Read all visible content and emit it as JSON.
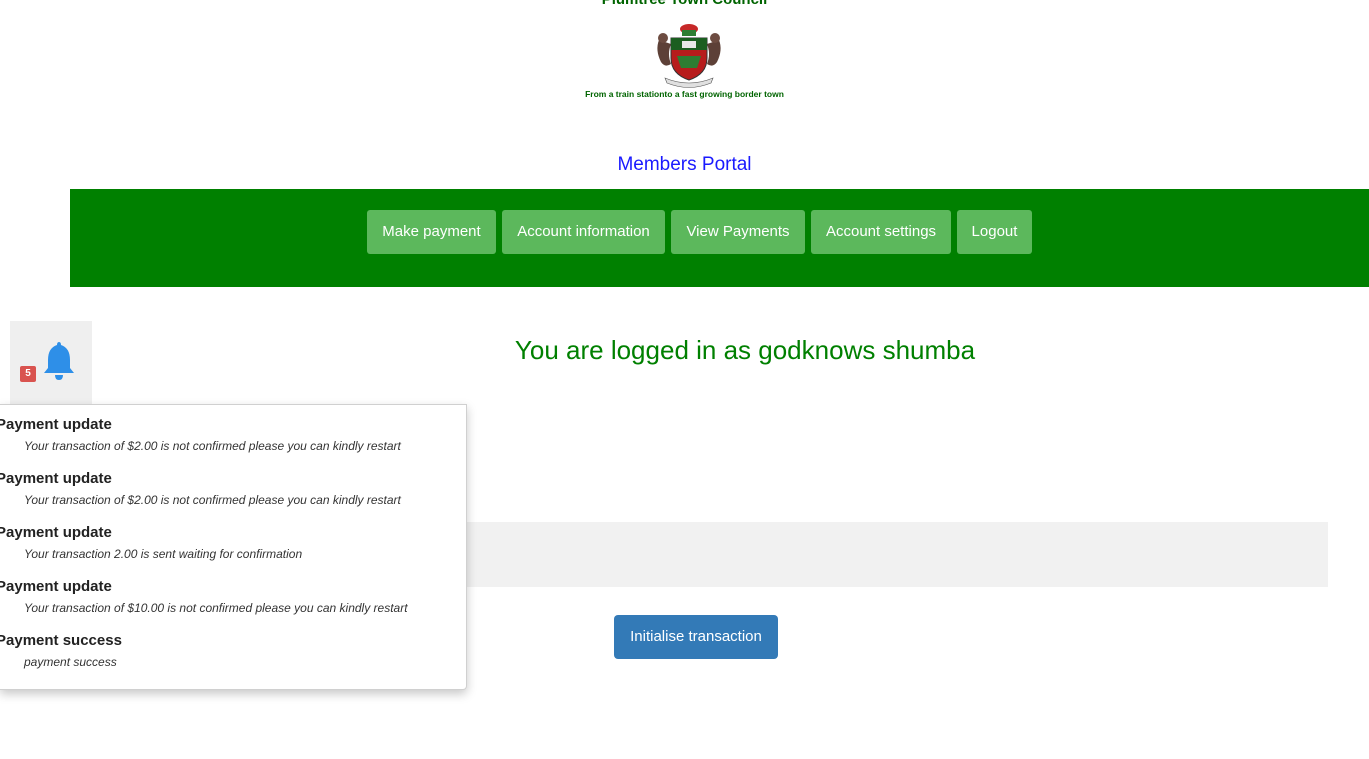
{
  "header": {
    "council_name": "Plumtree Town Council",
    "motto": "From a train stationto a fast growing border town",
    "portal_title": "Members Portal"
  },
  "nav": {
    "items": [
      {
        "label": "Make payment"
      },
      {
        "label": "Account information"
      },
      {
        "label": "View Payments"
      },
      {
        "label": "Account settings"
      },
      {
        "label": "Logout"
      }
    ]
  },
  "notifications": {
    "count": "5",
    "icon": "bell-icon",
    "items": [
      {
        "title": "Payment update",
        "message": "Your transaction of $2.00 is not confirmed please you can kindly restart"
      },
      {
        "title": "Payment update",
        "message": "Your transaction of $2.00 is not confirmed please you can kindly restart"
      },
      {
        "title": "Payment update",
        "message": "Your transaction 2.00 is sent waiting for confirmation"
      },
      {
        "title": "Payment update",
        "message": "Your transaction of $10.00 is not confirmed please you can kindly restart"
      },
      {
        "title": "Payment success",
        "message": "payment success"
      }
    ]
  },
  "main": {
    "welcome": "You are logged in as godknows shumba",
    "initialise_label": "Initialise transaction"
  },
  "colors": {
    "nav_bg": "#008000",
    "nav_button": "#5cb85c",
    "primary_button": "#337ab7",
    "badge": "#d9534f",
    "bell": "#2e8fe8"
  }
}
